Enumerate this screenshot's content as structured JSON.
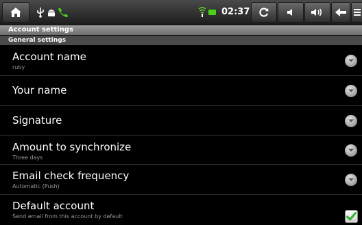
{
  "status_bar": {
    "time": "02:37",
    "icons": [
      "home-icon",
      "usb-icon",
      "android-icon",
      "phone-icon",
      "wifi-icon",
      "battery-icon",
      "refresh-icon",
      "volume-down-icon",
      "volume-up-icon",
      "back-icon",
      "menu-icon"
    ],
    "colors": {
      "battery": "#4ccf1a",
      "phone": "#4ccf1a",
      "wifi": "#5fd32a"
    }
  },
  "header": {
    "title": "Account settings",
    "section": "General settings"
  },
  "settings": {
    "items": [
      {
        "title": "Account name",
        "summary": "ruby",
        "control": "chevron"
      },
      {
        "title": "Your name",
        "summary": "",
        "control": "chevron"
      },
      {
        "title": "Signature",
        "summary": "",
        "control": "chevron"
      },
      {
        "title": "Amount to synchronize",
        "summary": "Three days",
        "control": "chevron"
      },
      {
        "title": "Email check frequency",
        "summary": "Automatic (Push)",
        "control": "chevron"
      },
      {
        "title": "Default account",
        "summary": "Send email from this account by default",
        "control": "checkbox",
        "checked": true
      }
    ]
  },
  "colors": {
    "checkmark": "#2fb52f",
    "background": "#000000"
  }
}
